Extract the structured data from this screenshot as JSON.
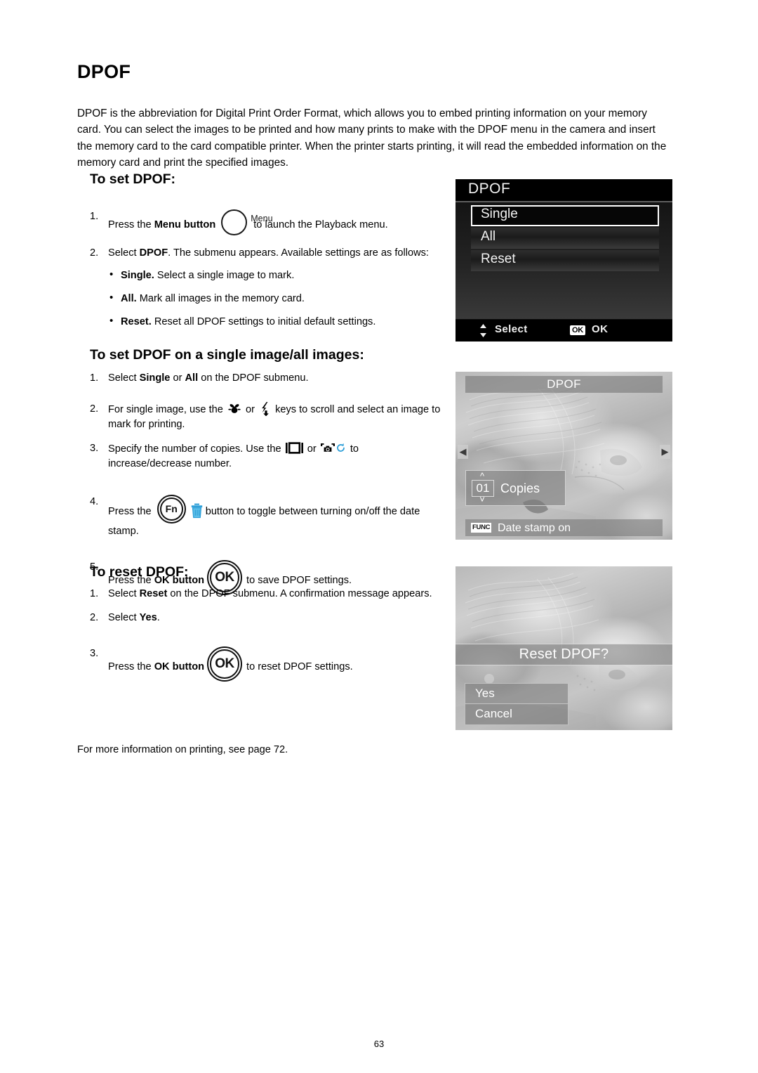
{
  "document": {
    "title": "DPOF",
    "page_number": "63",
    "intro": "DPOF is the abbreviation for Digital Print Order Format, which allows you to embed printing information on your memory card. You can select the images to be printed and how many prints to make with the DPOF menu in the camera and insert the memory card to the card compatible printer. When the printer starts printing, it will read the embedded information on the memory card and print the specified images.",
    "footnote": "For more information on printing, see page 72."
  },
  "section_set": {
    "heading": "To set DPOF:",
    "step1": {
      "num": "1.",
      "pre": "Press the ",
      "bold": "Menu button",
      "menu_label": "Menu",
      "post": "to launch the Playback menu."
    },
    "step2": {
      "num": "2.",
      "pre": "Select ",
      "bold": "DPOF",
      "post": ". The submenu appears. Available settings are as follows:"
    },
    "bullets": [
      {
        "term": "Single.",
        "text": "Select a single image to mark."
      },
      {
        "term": "All.",
        "text": "Mark all images in the memory card."
      },
      {
        "term": "Reset.",
        "text": "Reset all DPOF settings to initial default settings."
      }
    ]
  },
  "section_single": {
    "heading": "To set DPOF on a single image/all images:",
    "step1": {
      "num": "1.",
      "pre": "Select ",
      "bold1": "Single",
      "mid": " or ",
      "bold2": "All",
      "post": " on the DPOF submenu."
    },
    "step2": {
      "num": "2.",
      "pre": "For single image, use the ",
      "mid": " or ",
      "post": " keys to scroll and select an image to mark for printing."
    },
    "step3": {
      "num": "3.",
      "pre": "Specify the number of copies. Use the ",
      "mid": " or ",
      "post": " to increase/decrease number."
    },
    "step4": {
      "num": "4.",
      "pre": "Press the ",
      "fn_label": "Fn",
      "post": "button to toggle between turning on/off the date stamp."
    },
    "step5": {
      "num": "5.",
      "pre": "Press the ",
      "bold": "OK button",
      "ok_label": "OK",
      "post": "to save DPOF settings."
    }
  },
  "section_reset": {
    "heading": "To reset DPOF:",
    "step1": {
      "num": "1.",
      "pre": "Select ",
      "bold": "Reset",
      "post": " on the DPOF submenu. A confirmation message appears."
    },
    "step2": {
      "num": "2.",
      "pre": "Select ",
      "bold": "Yes",
      "post": "."
    },
    "step3": {
      "num": "3.",
      "pre": "Press the ",
      "bold": "OK button",
      "ok_label": "OK",
      "post": "to reset DPOF settings."
    }
  },
  "screens": {
    "dpof_menu": {
      "title": "DPOF",
      "items": [
        {
          "label": "Single",
          "selected": true
        },
        {
          "label": "All",
          "selected": false
        },
        {
          "label": "Reset",
          "selected": false
        }
      ],
      "status_select": "Select",
      "status_ok_badge": "OK",
      "status_ok": "OK"
    },
    "dpof_copies": {
      "title": "DPOF",
      "copies_value": "01",
      "copies_label": "Copies",
      "func_badge": "FUNC",
      "date_stamp": "Date stamp on",
      "nav_left": "◀",
      "nav_right": "▶"
    },
    "dpof_reset": {
      "prompt": "Reset DPOF?",
      "options": [
        {
          "label": "Yes",
          "selected": true
        },
        {
          "label": "Cancel",
          "selected": false
        }
      ]
    }
  },
  "colors": {
    "accent_blue": "#2e9fd8",
    "lcd_black": "#0d0d0d",
    "lcd_text": "#f2f2f2"
  }
}
